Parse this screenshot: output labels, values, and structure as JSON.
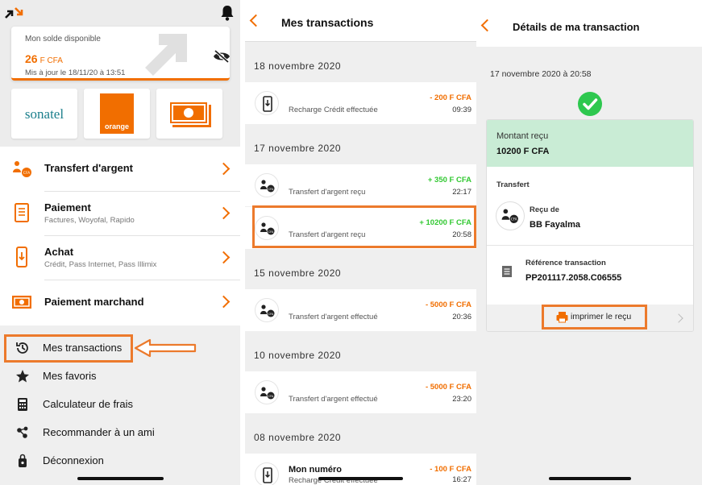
{
  "colors": {
    "accent": "#f16e00",
    "positive": "#32c832",
    "highlight": "#ec7a2c",
    "success_bg": "#c9ecd5"
  },
  "home": {
    "balance": {
      "label": "Mon solde disponible",
      "amount": "26",
      "currency": "F CFA",
      "updated": "Mis à jour le 18/11/20 à 13:51"
    },
    "brands": [
      {
        "name": "sonatel"
      },
      {
        "name": "orange"
      },
      {
        "icon": "banknote-icon"
      }
    ],
    "menu": [
      {
        "title": "Transfert d'argent",
        "subtitle": "",
        "icon": "transfer-icon"
      },
      {
        "title": "Paiement",
        "subtitle": "Factures, Woyofal, Rapido",
        "icon": "bill-icon"
      },
      {
        "title": "Achat",
        "subtitle": "Crédit, Pass Internet, Pass Illimix",
        "icon": "phone-icon"
      },
      {
        "title": "Paiement marchand",
        "subtitle": "",
        "icon": "cash-icon"
      }
    ],
    "links": [
      {
        "label": "Mes transactions",
        "icon": "history-icon"
      },
      {
        "label": "Mes favoris",
        "icon": "star-icon"
      },
      {
        "label": "Calculateur de frais",
        "icon": "calculator-icon"
      },
      {
        "label": "Recommander à un ami",
        "icon": "share-icon"
      },
      {
        "label": "Déconnexion",
        "icon": "logout-icon"
      }
    ]
  },
  "transactions": {
    "title": "Mes transactions",
    "groups": [
      {
        "date": "18 novembre 2020",
        "items": [
          {
            "desc": "Recharge Crédit effectuée",
            "amount": "- 200 F CFA",
            "time": "09:39"
          }
        ]
      },
      {
        "date": "17 novembre 2020",
        "items": [
          {
            "desc": "Transfert d'argent reçu",
            "amount": "+ 350 F CFA",
            "time": "22:17"
          },
          {
            "desc": "Transfert d'argent reçu",
            "amount": "+ 10200 F CFA",
            "time": "20:58"
          }
        ]
      },
      {
        "date": "15 novembre 2020",
        "items": [
          {
            "desc": "Transfert d'argent effectué",
            "amount": "- 5000 F CFA",
            "time": "20:36"
          }
        ]
      },
      {
        "date": "10 novembre 2020",
        "items": [
          {
            "desc": "Transfert d'argent effectué",
            "amount": "- 5000 F CFA",
            "time": "23:20"
          }
        ]
      },
      {
        "date": "08 novembre 2020",
        "items": [
          {
            "title": "Mon numéro",
            "desc": "Recharge Crédit effectuée",
            "amount": "- 100 F CFA",
            "time": "16:27"
          }
        ]
      }
    ]
  },
  "details": {
    "title": "Détails de ma transaction",
    "datetime": "17 novembre 2020 à 20:58",
    "amount_label": "Montant reçu",
    "amount_value": "10200 F CFA",
    "section": "Transfert",
    "from_label": "Reçu de",
    "from_name": "BB Fayalma",
    "ref_label": "Référence transaction",
    "ref_value": "PP201117.2058.C06555",
    "print_label": "imprimer le reçu"
  }
}
